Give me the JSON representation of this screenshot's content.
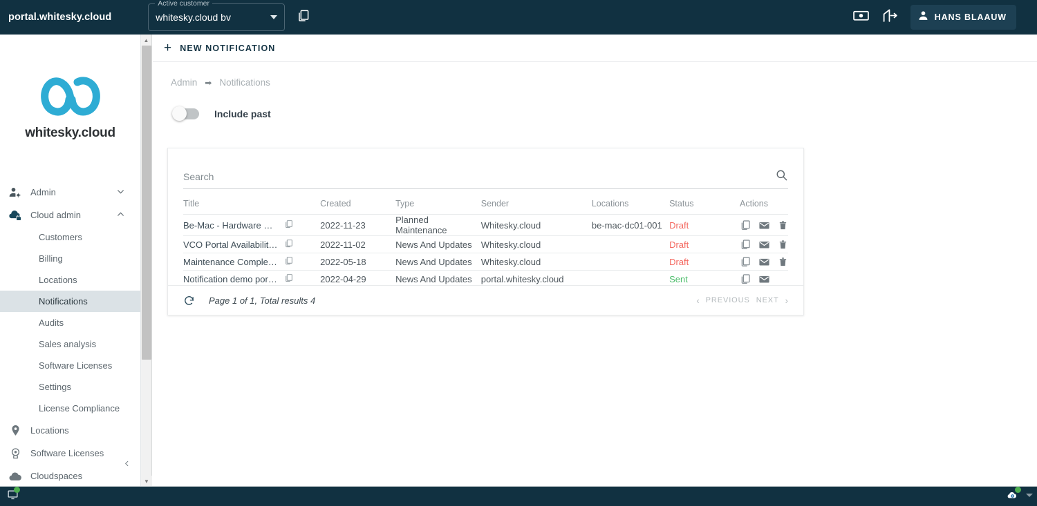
{
  "topbar": {
    "brand": "portal.whitesky.cloud",
    "customer_label": "Active customer",
    "customer_value": "whitesky.cloud bv",
    "copy_icon": "copy-icon",
    "billing_icon": "banknote-icon",
    "logout_icon": "logout-icon",
    "user_icon": "person-icon",
    "user_name": "HANS BLAAUW"
  },
  "sidebar": {
    "logo_text": "whitesky.cloud",
    "collapse_icon": "chevron-left-icon",
    "items": [
      {
        "label": "Admin",
        "icon": "person-gear-icon",
        "chevron": "chevron-down-icon",
        "type": "group",
        "active": false
      },
      {
        "label": "Cloud admin",
        "icon": "cloud-lock-icon",
        "chevron": "chevron-up-icon",
        "type": "group",
        "active": false
      },
      {
        "label": "Customers",
        "icon": "",
        "chevron": "",
        "type": "sub",
        "active": false
      },
      {
        "label": "Billing",
        "icon": "",
        "chevron": "",
        "type": "sub",
        "active": false
      },
      {
        "label": "Locations",
        "icon": "",
        "chevron": "",
        "type": "sub",
        "active": false
      },
      {
        "label": "Notifications",
        "icon": "",
        "chevron": "",
        "type": "sub",
        "active": true
      },
      {
        "label": "Audits",
        "icon": "",
        "chevron": "",
        "type": "sub",
        "active": false
      },
      {
        "label": "Sales analysis",
        "icon": "",
        "chevron": "",
        "type": "sub",
        "active": false
      },
      {
        "label": "Software Licenses",
        "icon": "",
        "chevron": "",
        "type": "sub",
        "active": false
      },
      {
        "label": "Settings",
        "icon": "",
        "chevron": "",
        "type": "sub",
        "active": false
      },
      {
        "label": "License Compliance",
        "icon": "",
        "chevron": "",
        "type": "sub",
        "active": false
      },
      {
        "label": "Locations",
        "icon": "map-pin-icon",
        "chevron": "",
        "type": "top",
        "active": false
      },
      {
        "label": "Software Licenses",
        "icon": "license-badge-icon",
        "chevron": "",
        "type": "top",
        "active": false
      },
      {
        "label": "Cloudspaces",
        "icon": "cloud-icon",
        "chevron": "",
        "type": "top",
        "active": false
      }
    ]
  },
  "main": {
    "new_button": "NEW NOTIFICATION",
    "plus_icon": "plus-icon",
    "breadcrumb": {
      "root": "Admin",
      "arrow_icon": "arrow-right-icon",
      "current": "Notifications"
    },
    "toggle": {
      "label": "Include past",
      "state": "off"
    }
  },
  "table": {
    "search_placeholder": "Search",
    "search_value": "",
    "search_icon": "search-icon",
    "columns": [
      "Title",
      "Created",
      "Type",
      "Sender",
      "Locations",
      "Status",
      "Actions"
    ],
    "rows": [
      {
        "title": "Be-Mac - Hardware Upgr...",
        "created": "2022-11-23",
        "type": "Planned Maintenance",
        "sender": "Whitesky.cloud",
        "locations": "be-mac-dc01-001",
        "status": "Draft",
        "status_kind": "draft",
        "actions": [
          "copy-icon",
          "envelope-icon",
          "trash-icon"
        ]
      },
      {
        "title": "VCO Portal Availability Is...",
        "created": "2022-11-02",
        "type": "News And Updates",
        "sender": "Whitesky.cloud",
        "locations": "",
        "status": "Draft",
        "status_kind": "draft",
        "actions": [
          "copy-icon",
          "envelope-icon",
          "trash-icon"
        ]
      },
      {
        "title": "Maintenance Completed ...",
        "created": "2022-05-18",
        "type": "News And Updates",
        "sender": "Whitesky.cloud",
        "locations": "",
        "status": "Draft",
        "status_kind": "draft",
        "actions": [
          "copy-icon",
          "envelope-icon",
          "trash-icon"
        ]
      },
      {
        "title": "Notification demo portal....",
        "created": "2022-04-29",
        "type": "News And Updates",
        "sender": "portal.whitesky.cloud",
        "locations": "",
        "status": "Sent",
        "status_kind": "sent",
        "actions": [
          "copy-icon",
          "envelope-icon"
        ]
      }
    ],
    "footer": {
      "refresh_icon": "refresh-icon",
      "page_info": "Page 1 of 1, Total results 4",
      "previous": "PREVIOUS",
      "next": "NEXT"
    }
  },
  "taskbar": {
    "left_icon": "monitor-icon",
    "right_icon": "eye-cloud-icon",
    "caret_icon": "caret-down-icon"
  },
  "colors": {
    "header_bg": "#113141",
    "brand_cyan": "#2eacd4",
    "status_draft": "#f4685f",
    "status_sent": "#4bbd6a",
    "active_item_bg": "#dbe2e6"
  }
}
